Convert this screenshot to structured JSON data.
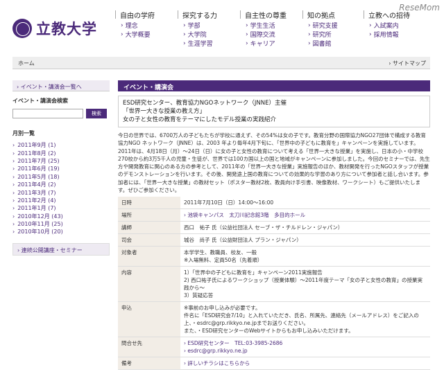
{
  "header": {
    "logo_text": "立教大学",
    "watermark": "ReseMom",
    "nav": [
      {
        "head": "自由の学府",
        "items": [
          "理念",
          "大学概要"
        ]
      },
      {
        "head": "探究する力",
        "items": [
          "学部",
          "大学院",
          "生涯学習"
        ]
      },
      {
        "head": "自主性の尊重",
        "items": [
          "学生生活",
          "国際交流",
          "キャリア"
        ]
      },
      {
        "head": "知の拠点",
        "items": [
          "研究支援",
          "研究所",
          "図書館"
        ]
      },
      {
        "head": "立教への招待",
        "items": [
          "入試案内",
          "採用情報"
        ]
      }
    ]
  },
  "breadcrumb": {
    "home": "ホーム",
    "sitemap": "サイトマップ"
  },
  "sidebar": {
    "event_list": "イベント・講演会一覧へ",
    "search_title": "イベント・講演会検索",
    "search_button": "検索",
    "monthly_title": "月別一覧",
    "months": [
      "2011年9月 (1)",
      "2011年8月 (2)",
      "2011年7月 (25)",
      "2011年6月 (19)",
      "2011年5月 (18)",
      "2011年4月 (2)",
      "2011年3月 (7)",
      "2011年2月 (4)",
      "2011年1月 (7)",
      "2010年12月 (43)",
      "2010年11月 (25)",
      "2010年10月 (20)"
    ],
    "lecture_link": "連続公開講座・セミナー"
  },
  "main": {
    "page_title": "イベント・講演会",
    "event_head": [
      "ESD研究センター、教育協力NGOネットワーク（JNNE）主催",
      "「世界一大きな授業の教え方」",
      "女の子と女性の教育をテーマにしたモデル授業の実践紹介"
    ],
    "intro": "今日の世界では、6700万人の子どもたちが学校に通えず、その54%は女の子です。教育分野の国際協力NGO27団体で構成する教育協力NGO ネットワーク（JNNE）は、2003 年より毎年4月下旬に、「世界中の子どもに教育を」キャンペーンを実施しています。2011年は、4月18日（月）〜24日（日）に女の子と女性の教育について考える「世界一大きな授業」を実施し、日本の小・中学校270校から約3万5千人の児童・生徒が、世界では100カ国以上の国と地域がキャンペーンに参加しました。今回のセミナーでは、先生方や開発教育に関心のある方の参考として、2011年の「世界一大きな授業」実施報告のほか、教材開発を行ったNGOスタッフが授業のデモンストレーションを行います。その後、開発途上国の教育についての効果的な学習のあり方について参加者と話し合います。参加者には、「世界一大きな授業」の教材セット（ポスター教材2枚、教員向け手引書、映像教材、ワークシート）もご提供いたします。ぜひご参加ください。",
    "rows": [
      {
        "k": "日時",
        "v": [
          "2011年7月10日（日）14:00〜16:00"
        ]
      },
      {
        "k": "場所",
        "v": [
          "池袋キャンパス　太刀川記念館3階　多目的ホール"
        ],
        "link": true
      },
      {
        "k": "講師",
        "v": [
          "西口　祐子 氏（公益社団法人 セーブ・ザ・チルドレン・ジャパン）"
        ]
      },
      {
        "k": "司会",
        "v": [
          "城谷　尚子 氏（公益財団法人 プラン・ジャパン）"
        ]
      },
      {
        "k": "対象者",
        "v": [
          "本学学生、教職員、校友、一般",
          "※入場無料、定員50名（先着順）"
        ]
      },
      {
        "k": "内容",
        "v": [
          "1）「世界中の子どもに教育を」キャンペーン2011実施報告",
          "2) 西口祐子氏によるワークショップ（授業体験）〜2011年度テーマ「女の子と女性の教育」の授業実践から〜",
          "3）質疑応答"
        ]
      },
      {
        "k": "申込",
        "v": [
          "※事前のお申し込みが必要です。",
          "件名に「ESD研究会7/10」と入れていただき、氏名、所属先、連絡先（メールアドレス）をご記入の上、・esdrc@grp.rikkyo.ne.jpまでお送りください。",
          "また、・ESD研究センターのWebサイトからもお申し込みいただけます。"
        ]
      },
      {
        "k": "問合せ先",
        "v": [
          "ESD研究センター　TEL:03-3985-2686",
          "esdrc@grp.rikkyo.ne.jp"
        ],
        "link": true
      },
      {
        "k": "備考",
        "v": [
          "詳しいチラシはこちらから"
        ],
        "link": true
      }
    ]
  }
}
